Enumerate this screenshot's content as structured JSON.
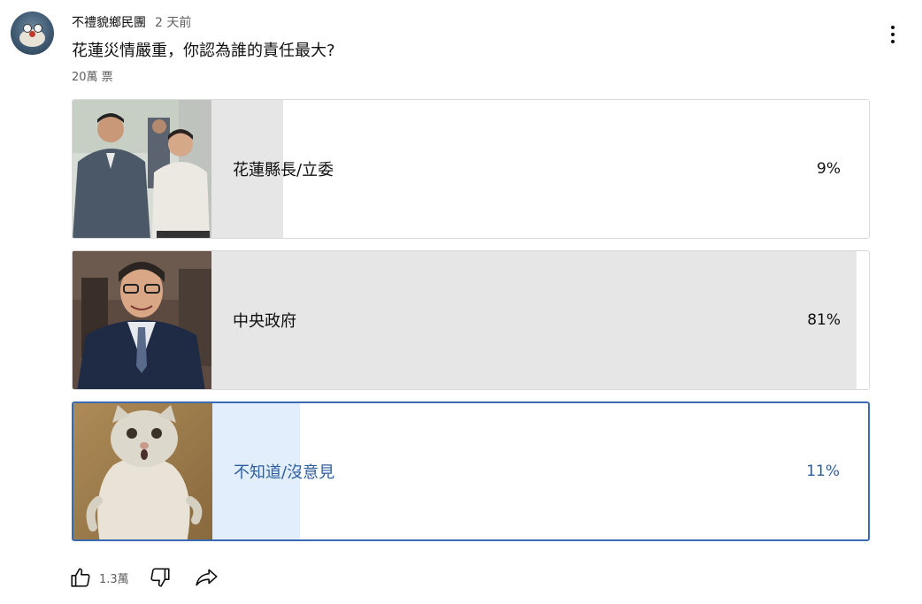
{
  "post": {
    "author": "不禮貌鄉民團",
    "time": "2 天前",
    "question": "花蓮災情嚴重，你認為誰的責任最大?",
    "votes": "20萬 票"
  },
  "poll": {
    "options": [
      {
        "label": "花蓮縣長/立委",
        "percent_text": "9%",
        "percent": 9,
        "selected": false
      },
      {
        "label": "中央政府",
        "percent_text": "81%",
        "percent": 81,
        "selected": false
      },
      {
        "label": "不知道/沒意見",
        "percent_text": "11%",
        "percent": 11,
        "selected": true
      }
    ]
  },
  "actions": {
    "like_count": "1.3萬",
    "icons": [
      "thumbs-up-icon",
      "thumbs-down-icon",
      "share-icon"
    ]
  },
  "colors": {
    "selected_border": "#3b6ab5",
    "selected_fill": "#e2eefb",
    "selected_text": "#2f5e9e",
    "result_fill": "#e6e6e6"
  }
}
